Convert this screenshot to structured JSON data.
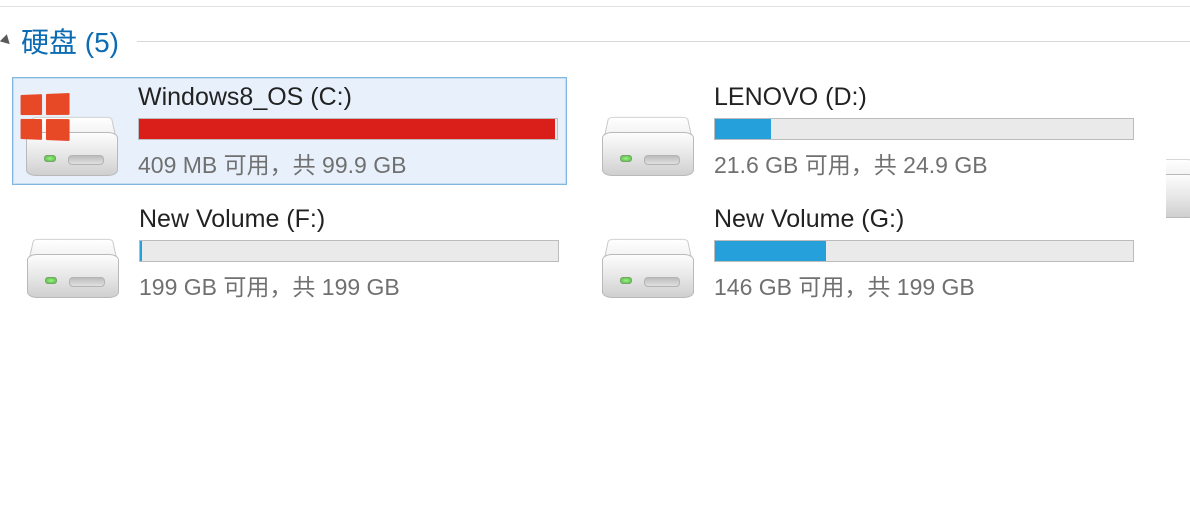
{
  "section": {
    "title": "硬盘 (5)"
  },
  "drives": [
    {
      "name": "Windows8_OS (C:)",
      "status": "409 MB 可用，共 99.9 GB",
      "fill_percent": 99.6,
      "fill_color": "red",
      "selected": true,
      "has_win_badge": true
    },
    {
      "name": "LENOVO (D:)",
      "status": "21.6 GB 可用，共 24.9 GB",
      "fill_percent": 13.3,
      "fill_color": "blue",
      "selected": false,
      "has_win_badge": false
    },
    {
      "name": "New Volume (F:)",
      "status": "199 GB 可用，共 199 GB",
      "fill_percent": 0.5,
      "fill_color": "blue",
      "selected": false,
      "has_win_badge": false
    },
    {
      "name": "New Volume (G:)",
      "status": "146 GB 可用，共 199 GB",
      "fill_percent": 26.6,
      "fill_color": "blue",
      "selected": false,
      "has_win_badge": false
    }
  ]
}
